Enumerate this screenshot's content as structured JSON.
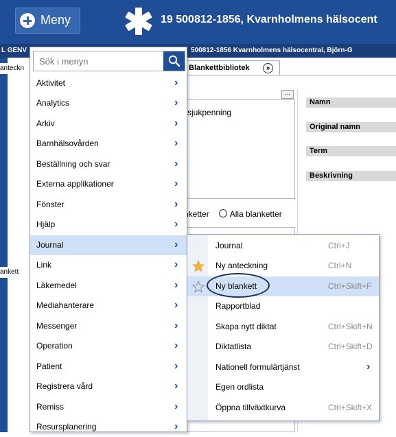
{
  "header": {
    "menu_label": "Meny",
    "patient_title": "19 500812-1856,  Kvarnholmens hälsocent",
    "sub_left": "L GENV",
    "sub_right": "500812-1856 Kvarnholmens hälsocentral, Björn-G",
    "left_tab": "anteckn",
    "left_blankett": "ankett",
    "star_icon": "star-of-life-icon"
  },
  "library": {
    "tab_label": "Blankettbibliotek",
    "dots_label": "...",
    "list_item": "sjukpenning",
    "radio_left_label": "nketter",
    "radio_right_label": "Alla blanketter"
  },
  "props": {
    "name": "Namn",
    "original_name": "Original namn",
    "term": "Term",
    "description": "Beskrivning"
  },
  "menu": {
    "search_placeholder": "Sök i menyn",
    "items": [
      {
        "label": "Aktivitet"
      },
      {
        "label": "Analytics"
      },
      {
        "label": "Arkiv"
      },
      {
        "label": "Barnhälsovården"
      },
      {
        "label": "Beställning och svar"
      },
      {
        "label": "Externa applikationer"
      },
      {
        "label": "Fönster"
      },
      {
        "label": "Hjälp"
      },
      {
        "label": "Journal"
      },
      {
        "label": "Link"
      },
      {
        "label": "Läkemedel"
      },
      {
        "label": "Mediahanterare"
      },
      {
        "label": "Messenger"
      },
      {
        "label": "Operation"
      },
      {
        "label": "Patient"
      },
      {
        "label": "Registrera vård"
      },
      {
        "label": "Remiss"
      },
      {
        "label": "Resursplanering"
      }
    ],
    "arrow": "›"
  },
  "submenu": {
    "items": [
      {
        "label": "Journal",
        "shortcut": "Ctrl+J"
      },
      {
        "label": "Ny anteckning",
        "shortcut": "Ctrl+N"
      },
      {
        "label": "Ny blankett",
        "shortcut": "Ctrl+Skift+F"
      },
      {
        "label": "Rapportblad",
        "shortcut": ""
      },
      {
        "label": "Skapa nytt diktat",
        "shortcut": "Ctrl+Skift+N"
      },
      {
        "label": "Diktatlista",
        "shortcut": "Ctrl+Skift+D"
      },
      {
        "label": "Nationell formulärtjänst",
        "shortcut": ""
      },
      {
        "label": "Egen ordlista",
        "shortcut": ""
      },
      {
        "label": "Öppna tillväxtkurva",
        "shortcut": "Ctrl+Skift+X"
      }
    ],
    "arrow": "›"
  },
  "colors": {
    "brand_blue": "#1f4e96",
    "highlight": "#cfe0f7",
    "star_gold": "#f3b43a"
  }
}
